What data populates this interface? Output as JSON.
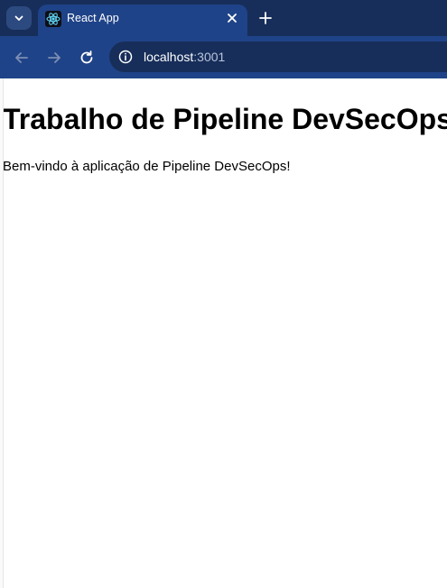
{
  "browser": {
    "tab": {
      "title": "React App",
      "favicon": "react-logo-icon"
    },
    "url": {
      "host": "localhost",
      "port": ":3001"
    },
    "icons": {
      "tab_menu": "chevron-down-icon",
      "close": "close-icon",
      "new_tab": "plus-icon",
      "back": "arrow-left-icon",
      "forward": "arrow-right-icon",
      "reload": "reload-icon",
      "site_info": "info-icon"
    },
    "colors": {
      "tabstrip": "#172e5a",
      "toolbar": "#1f4388",
      "omnibox": "#172e5a"
    }
  },
  "page": {
    "heading": "Trabalho de Pipeline DevSecOps",
    "welcome": "Bem-vindo à aplicação de Pipeline DevSecOps!"
  }
}
